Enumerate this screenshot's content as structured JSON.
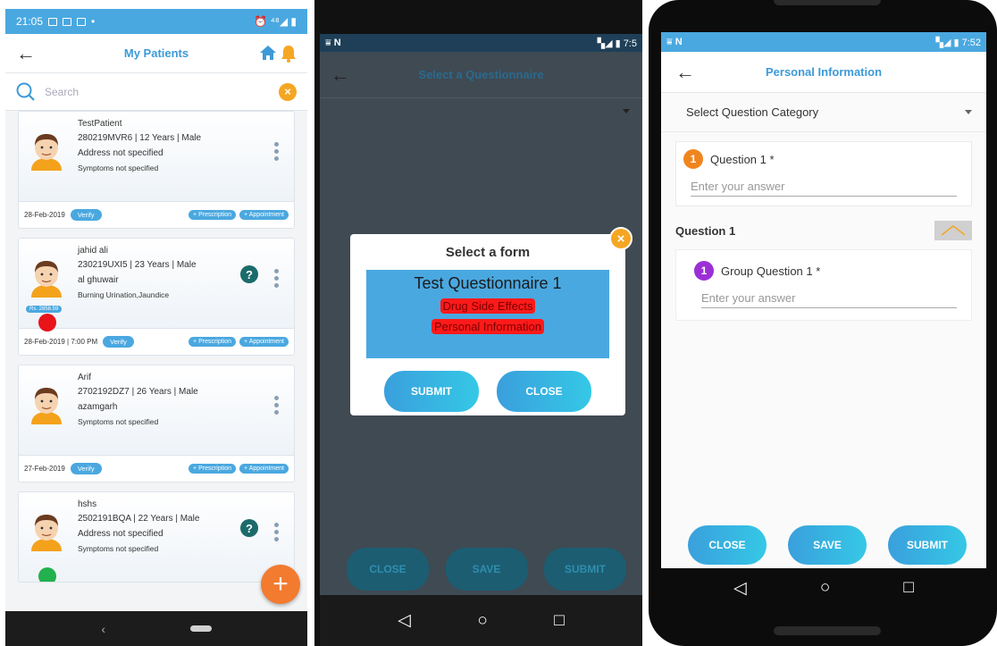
{
  "panel1": {
    "status_time": "21:05",
    "status_right": "⏰ ⁴⁸◢ ▮",
    "title": "My Patients",
    "search": {
      "placeholder": "Search"
    },
    "patients": [
      {
        "name": "TestPatient",
        "id_line": "280219MVR6 | 12 Years | Male",
        "address": "Address not specified",
        "symptoms": "Symptoms not specified",
        "date": "28-Feb-2019",
        "has_question": false,
        "amount": "",
        "dot_color": ""
      },
      {
        "name": "jahid ali",
        "id_line": "230219UXI5 | 23 Years | Male",
        "address": "al ghuwair",
        "symptoms": "Burning Urination,Jaundice",
        "date": "28-Feb-2019 | 7:00 PM",
        "has_question": true,
        "amount": "Rs. 2858.59",
        "dot_color": "#e8141a"
      },
      {
        "name": "Arif",
        "id_line": "2702192DZ7 | 26 Years | Male",
        "address": "azamgarh",
        "symptoms": "Symptoms not specified",
        "date": "27-Feb-2019",
        "has_question": false,
        "amount": "",
        "dot_color": ""
      },
      {
        "name": "hshs",
        "id_line": "2502191BQA | 22 Years | Male",
        "address": "Address not specified",
        "symptoms": "Symptoms not specified",
        "date": "",
        "has_question": true,
        "amount": "",
        "dot_color": "#22b14c"
      }
    ],
    "verify_label": "Verify",
    "prescription_label": "+ Prescription",
    "appointment_label": "+ Appointment",
    "question_mark": "?",
    "fab_label": "+"
  },
  "panel2": {
    "status_right": "▚◢ ▮ 7:5",
    "title": "Select a Questionnaire",
    "modal_title": "Select a form",
    "form_main": "Test Questionnaire 1",
    "form_items": [
      "Drug Side Effects",
      "Personal Information"
    ],
    "submit_label": "SUBMIT",
    "close_label": "CLOSE",
    "bottom_buttons": [
      "CLOSE",
      "SAVE",
      "SUBMIT"
    ]
  },
  "panel3": {
    "status_right": "▚◢ ▮ 7:52",
    "title": "Personal Information",
    "category_label": "Select Question Category",
    "question": {
      "number": "1",
      "label": "Question 1 *",
      "placeholder": "Enter your answer"
    },
    "section_label": "Question 1",
    "group_question": {
      "number": "1",
      "label": "Group Question 1 *",
      "placeholder": "Enter your answer"
    },
    "buttons": [
      "CLOSE",
      "SAVE",
      "SUBMIT"
    ]
  },
  "colors": {
    "primary": "#4aa8e0",
    "accent": "#f5a623",
    "fab": "#f27b2f",
    "orange_badge": "#f0851f",
    "purple_badge": "#9b2fd6"
  }
}
